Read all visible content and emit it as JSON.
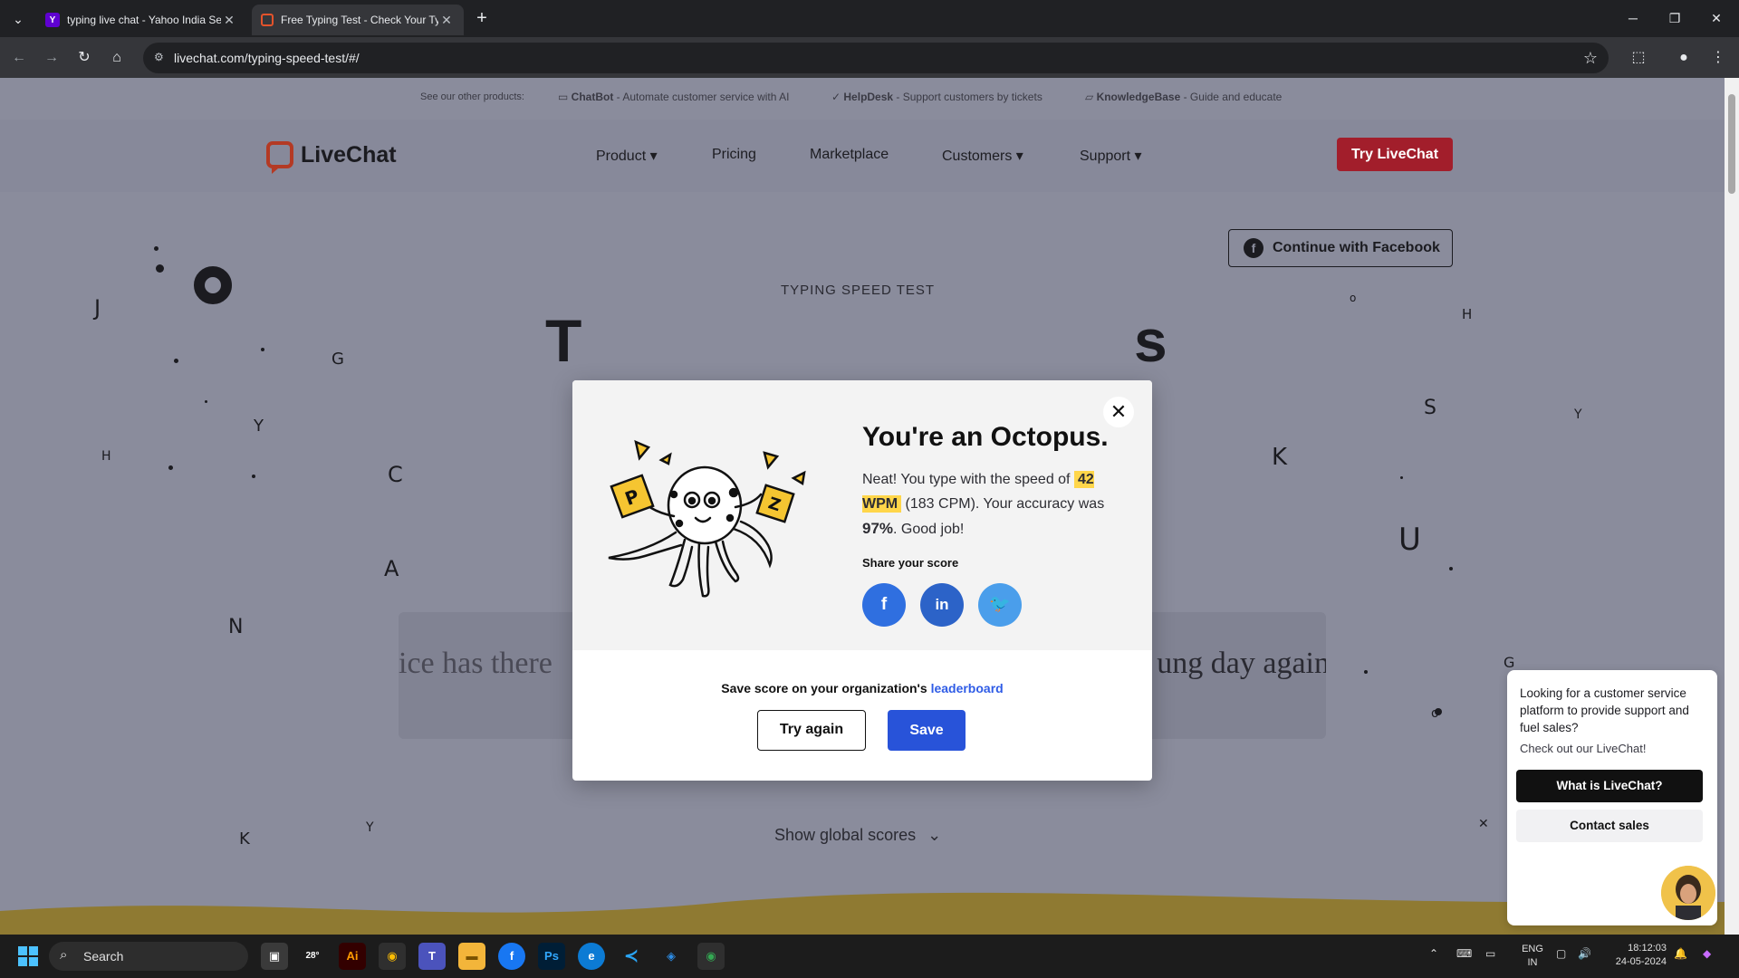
{
  "browser": {
    "tabs": [
      {
        "title": "typing live chat - Yahoo India Se",
        "favicon": "yahoo-icon",
        "active": false
      },
      {
        "title": "Free Typing Test - Check Your Ty",
        "favicon": "livechat-icon",
        "active": true
      }
    ],
    "url": "livechat.com/typing-speed-test/#/"
  },
  "products_bar": {
    "lead": "See our other products:",
    "items": [
      {
        "name": "ChatBot",
        "desc": " - Automate customer service with AI"
      },
      {
        "name": "HelpDesk",
        "desc": " - Support customers by tickets"
      },
      {
        "name": "KnowledgeBase",
        "desc": " - Guide and educate"
      }
    ]
  },
  "header": {
    "logo": "LiveChat",
    "nav": [
      "Product ▾",
      "Pricing",
      "Marketplace",
      "Customers ▾",
      "Support ▾"
    ],
    "cta": "Try LiveChat"
  },
  "hero": {
    "facebook_button": "Continue with Facebook",
    "eyebrow": "TYPING SPEED TEST",
    "title_left": "T",
    "title_right": "s",
    "typing_left": "ice has there",
    "typing_right": "ung day again",
    "global_scores": "Show global scores"
  },
  "modal": {
    "title": "You're an Octopus.",
    "desc_before": "Neat! You type with the speed of ",
    "wpm": "42 WPM",
    "desc_mid": " (183 CPM). Your accuracy was ",
    "accuracy": "97%",
    "desc_after": ". Good job!",
    "share_label": "Share your score",
    "share_buttons": [
      {
        "label": "f",
        "network": "facebook",
        "color": "#2f6fe0"
      },
      {
        "label": "in",
        "network": "linkedin",
        "color": "#2c63c8"
      },
      {
        "label": "t",
        "network": "twitter",
        "color": "#4a9eeb"
      }
    ],
    "save_text": "Save score on your organization's ",
    "save_link": "leaderboard",
    "try_again": "Try again",
    "save": "Save"
  },
  "chat_popup": {
    "message": "Looking for a customer service platform to provide support and fuel sales?",
    "sub": "Check out our LiveChat!",
    "primary": "What is LiveChat?",
    "secondary": "Contact sales"
  },
  "taskbar": {
    "search": "Search",
    "weather": "28°",
    "language_line1": "ENG",
    "language_line2": "IN",
    "time": "18:12:03",
    "date": "24-05-2024"
  },
  "colors": {
    "accent_red": "#a21e2b",
    "save_blue": "#2853d9",
    "wpm_highlight": "#ffd64a",
    "page_overlay": "#8a8c9c"
  }
}
